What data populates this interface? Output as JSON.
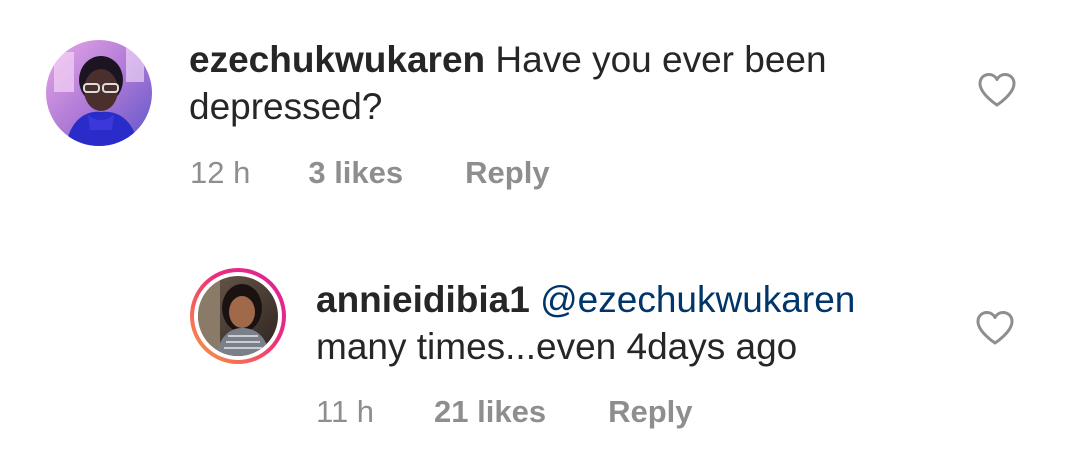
{
  "comments": [
    {
      "username": "ezechukwukaren",
      "text": "Have you ever been depressed?",
      "time": "12 h",
      "likes": "3 likes",
      "reply_label": "Reply",
      "avatar_icon": "user-avatar-icon",
      "like_icon": "heart-outline-icon"
    },
    {
      "username": "annieidibia1",
      "mention": "@ezechukwukaren",
      "text": "many times...even 4days ago",
      "time": "11 h",
      "likes": "21 likes",
      "reply_label": "Reply",
      "avatar_icon": "user-avatar-icon",
      "like_icon": "heart-outline-icon"
    }
  ],
  "colors": {
    "text": "#262626",
    "meta": "#8e8e8e",
    "mention": "#003569",
    "story_ring_start": "#f9a13b",
    "story_ring_end": "#d6249f"
  }
}
